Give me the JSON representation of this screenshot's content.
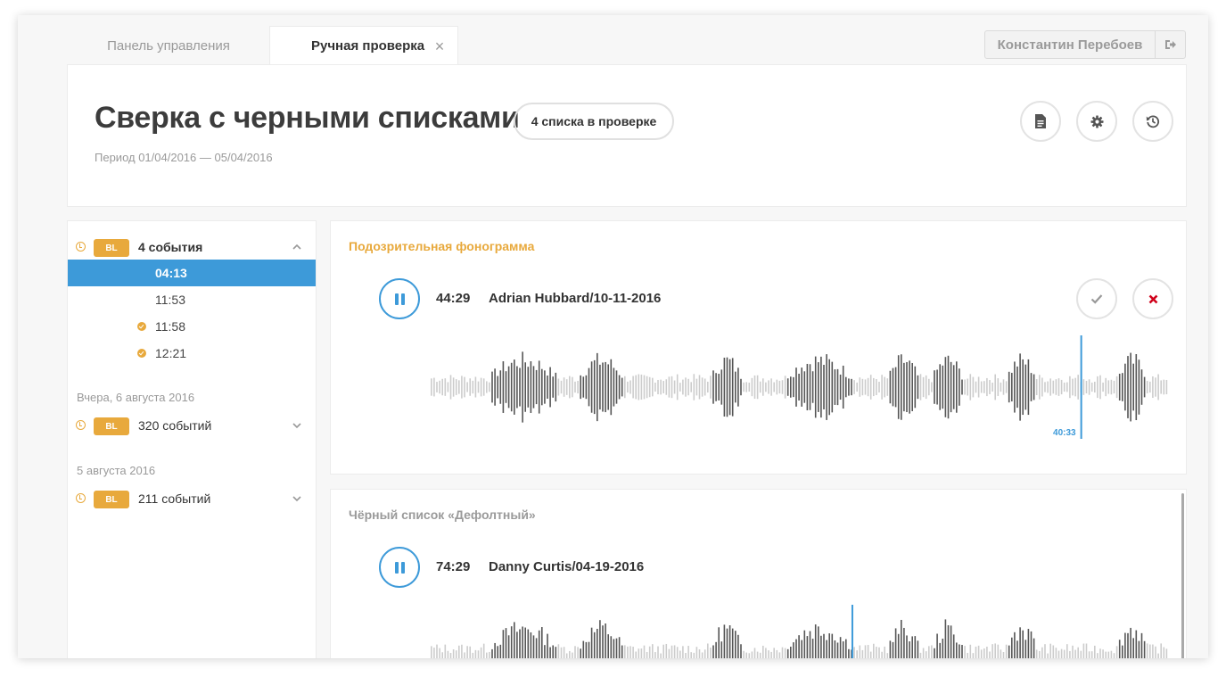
{
  "tabs": {
    "dashboard": "Панель управления",
    "manual": "Ручная проверка",
    "close_glyph": "×"
  },
  "user": {
    "name": "Константин Перебоев"
  },
  "header": {
    "title": "Сверка с черными списками",
    "lists_badge": "4 списка в проверке",
    "period": "Период 01/04/2016 — 05/04/2016",
    "icons": [
      "document-icon",
      "gear-icon",
      "history-icon"
    ]
  },
  "sidebar": {
    "groups": [
      {
        "badge": "BL",
        "count": "4 события",
        "expanded": true,
        "events": [
          {
            "time": "04:13",
            "selected": true,
            "checked": false
          },
          {
            "time": "11:53",
            "selected": false,
            "checked": false
          },
          {
            "time": "11:58",
            "selected": false,
            "checked": true
          },
          {
            "time": "12:21",
            "selected": false,
            "checked": true
          }
        ]
      },
      {
        "date": "Вчера, 6 августа 2016",
        "badge": "BL",
        "count": "320 событий",
        "expanded": false
      },
      {
        "date": "5 августа 2016",
        "badge": "BL",
        "count": "211 событий",
        "expanded": false
      }
    ]
  },
  "cards": [
    {
      "title": "Подозрительная фонограмма",
      "duration": "44:29",
      "track": "Adrian Hubbard/10-11-2016",
      "marker_time": "40:33",
      "progress": 0.88
    },
    {
      "title": "Чёрный список «Дефолтный»",
      "duration": "74:29",
      "track": "Danny Curtis/04-19-2016",
      "progress": 0.57
    }
  ],
  "colors": {
    "accent_blue": "#3d9ad9",
    "accent_orange": "#e8a93c",
    "reject_red": "#d0021b",
    "wave_dark": "#555555",
    "wave_light": "#cccccc"
  }
}
